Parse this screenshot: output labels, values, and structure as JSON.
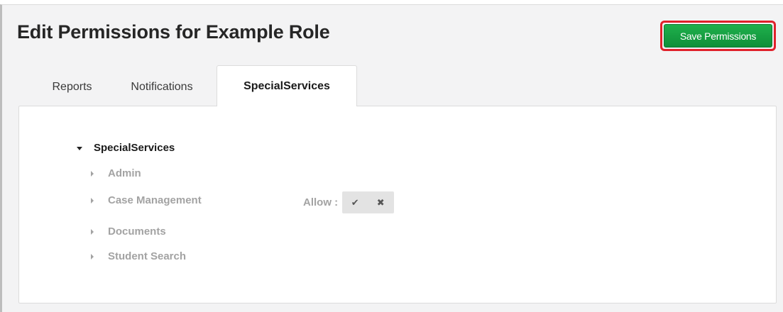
{
  "page": {
    "title": "Edit Permissions for Example Role"
  },
  "toolbar": {
    "save_label": "Save Permissions"
  },
  "tabs": [
    {
      "label": "Reports",
      "active": false
    },
    {
      "label": "Notifications",
      "active": false
    },
    {
      "label": "SpecialServices",
      "active": true
    }
  ],
  "tree": {
    "root_label": "SpecialServices",
    "items": [
      {
        "label": "Admin"
      },
      {
        "label": "Case Management"
      },
      {
        "label": "Documents"
      },
      {
        "label": "Student Search"
      }
    ]
  },
  "allow": {
    "label": "Allow :",
    "check_icon": "✔",
    "cross_icon": "✖"
  },
  "colors": {
    "accent_green": "#169a40",
    "highlight_red": "#e0212b",
    "muted_text": "#a3a3a3"
  }
}
